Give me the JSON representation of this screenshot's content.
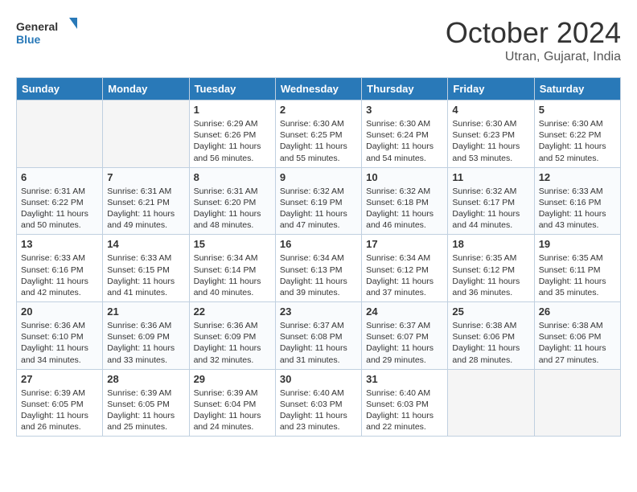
{
  "logo": {
    "line1": "General",
    "line2": "Blue"
  },
  "title": "October 2024",
  "location": "Utran, Gujarat, India",
  "headers": [
    "Sunday",
    "Monday",
    "Tuesday",
    "Wednesday",
    "Thursday",
    "Friday",
    "Saturday"
  ],
  "weeks": [
    [
      {
        "day": "",
        "info": ""
      },
      {
        "day": "",
        "info": ""
      },
      {
        "day": "1",
        "info": "Sunrise: 6:29 AM\nSunset: 6:26 PM\nDaylight: 11 hours and 56 minutes."
      },
      {
        "day": "2",
        "info": "Sunrise: 6:30 AM\nSunset: 6:25 PM\nDaylight: 11 hours and 55 minutes."
      },
      {
        "day": "3",
        "info": "Sunrise: 6:30 AM\nSunset: 6:24 PM\nDaylight: 11 hours and 54 minutes."
      },
      {
        "day": "4",
        "info": "Sunrise: 6:30 AM\nSunset: 6:23 PM\nDaylight: 11 hours and 53 minutes."
      },
      {
        "day": "5",
        "info": "Sunrise: 6:30 AM\nSunset: 6:22 PM\nDaylight: 11 hours and 52 minutes."
      }
    ],
    [
      {
        "day": "6",
        "info": "Sunrise: 6:31 AM\nSunset: 6:22 PM\nDaylight: 11 hours and 50 minutes."
      },
      {
        "day": "7",
        "info": "Sunrise: 6:31 AM\nSunset: 6:21 PM\nDaylight: 11 hours and 49 minutes."
      },
      {
        "day": "8",
        "info": "Sunrise: 6:31 AM\nSunset: 6:20 PM\nDaylight: 11 hours and 48 minutes."
      },
      {
        "day": "9",
        "info": "Sunrise: 6:32 AM\nSunset: 6:19 PM\nDaylight: 11 hours and 47 minutes."
      },
      {
        "day": "10",
        "info": "Sunrise: 6:32 AM\nSunset: 6:18 PM\nDaylight: 11 hours and 46 minutes."
      },
      {
        "day": "11",
        "info": "Sunrise: 6:32 AM\nSunset: 6:17 PM\nDaylight: 11 hours and 44 minutes."
      },
      {
        "day": "12",
        "info": "Sunrise: 6:33 AM\nSunset: 6:16 PM\nDaylight: 11 hours and 43 minutes."
      }
    ],
    [
      {
        "day": "13",
        "info": "Sunrise: 6:33 AM\nSunset: 6:16 PM\nDaylight: 11 hours and 42 minutes."
      },
      {
        "day": "14",
        "info": "Sunrise: 6:33 AM\nSunset: 6:15 PM\nDaylight: 11 hours and 41 minutes."
      },
      {
        "day": "15",
        "info": "Sunrise: 6:34 AM\nSunset: 6:14 PM\nDaylight: 11 hours and 40 minutes."
      },
      {
        "day": "16",
        "info": "Sunrise: 6:34 AM\nSunset: 6:13 PM\nDaylight: 11 hours and 39 minutes."
      },
      {
        "day": "17",
        "info": "Sunrise: 6:34 AM\nSunset: 6:12 PM\nDaylight: 11 hours and 37 minutes."
      },
      {
        "day": "18",
        "info": "Sunrise: 6:35 AM\nSunset: 6:12 PM\nDaylight: 11 hours and 36 minutes."
      },
      {
        "day": "19",
        "info": "Sunrise: 6:35 AM\nSunset: 6:11 PM\nDaylight: 11 hours and 35 minutes."
      }
    ],
    [
      {
        "day": "20",
        "info": "Sunrise: 6:36 AM\nSunset: 6:10 PM\nDaylight: 11 hours and 34 minutes."
      },
      {
        "day": "21",
        "info": "Sunrise: 6:36 AM\nSunset: 6:09 PM\nDaylight: 11 hours and 33 minutes."
      },
      {
        "day": "22",
        "info": "Sunrise: 6:36 AM\nSunset: 6:09 PM\nDaylight: 11 hours and 32 minutes."
      },
      {
        "day": "23",
        "info": "Sunrise: 6:37 AM\nSunset: 6:08 PM\nDaylight: 11 hours and 31 minutes."
      },
      {
        "day": "24",
        "info": "Sunrise: 6:37 AM\nSunset: 6:07 PM\nDaylight: 11 hours and 29 minutes."
      },
      {
        "day": "25",
        "info": "Sunrise: 6:38 AM\nSunset: 6:06 PM\nDaylight: 11 hours and 28 minutes."
      },
      {
        "day": "26",
        "info": "Sunrise: 6:38 AM\nSunset: 6:06 PM\nDaylight: 11 hours and 27 minutes."
      }
    ],
    [
      {
        "day": "27",
        "info": "Sunrise: 6:39 AM\nSunset: 6:05 PM\nDaylight: 11 hours and 26 minutes."
      },
      {
        "day": "28",
        "info": "Sunrise: 6:39 AM\nSunset: 6:05 PM\nDaylight: 11 hours and 25 minutes."
      },
      {
        "day": "29",
        "info": "Sunrise: 6:39 AM\nSunset: 6:04 PM\nDaylight: 11 hours and 24 minutes."
      },
      {
        "day": "30",
        "info": "Sunrise: 6:40 AM\nSunset: 6:03 PM\nDaylight: 11 hours and 23 minutes."
      },
      {
        "day": "31",
        "info": "Sunrise: 6:40 AM\nSunset: 6:03 PM\nDaylight: 11 hours and 22 minutes."
      },
      {
        "day": "",
        "info": ""
      },
      {
        "day": "",
        "info": ""
      }
    ]
  ]
}
